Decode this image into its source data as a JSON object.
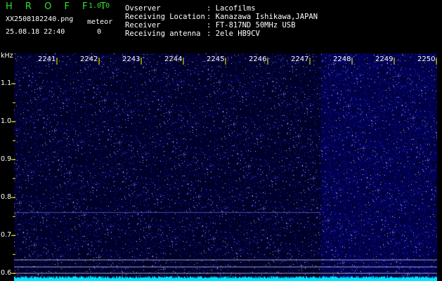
{
  "header": {
    "logo": "H R O F F T",
    "version": "1.0.0",
    "filename": "XX2508182240.png",
    "datetime": "25.08.18 22:40",
    "counter_label": "meteor",
    "counter_value": "0",
    "fields": [
      {
        "label": "Ovserver",
        "value": ": Lacofilms"
      },
      {
        "label": "Receiving Location",
        "value": ": Kanazawa Ishikawa,JAPAN"
      },
      {
        "label": "Receiver",
        "value": ": FT-817ND 50MHz USB"
      },
      {
        "label": "Receiving antenna",
        "value": ": 2ele HB9CV"
      }
    ]
  },
  "chart_data": {
    "type": "heatmap",
    "ylabel": "kHz",
    "x_ticks": [
      "2241",
      "2242",
      "2243",
      "2244",
      "2245",
      "2246",
      "2247",
      "2248",
      "2249",
      "2250"
    ],
    "y_ticks": [
      "1.1",
      "1.0",
      "0.9",
      "0.8",
      "0.7",
      "0.6"
    ],
    "ylim": [
      0.58,
      1.18
    ],
    "colors": {
      "background": "#000000",
      "low": "#0a0a3a",
      "mid": "#1a1acc",
      "high": "#8888ff",
      "baseline": "#00e5ff",
      "marker": "#ffffff",
      "tick": "#ffff00"
    }
  }
}
